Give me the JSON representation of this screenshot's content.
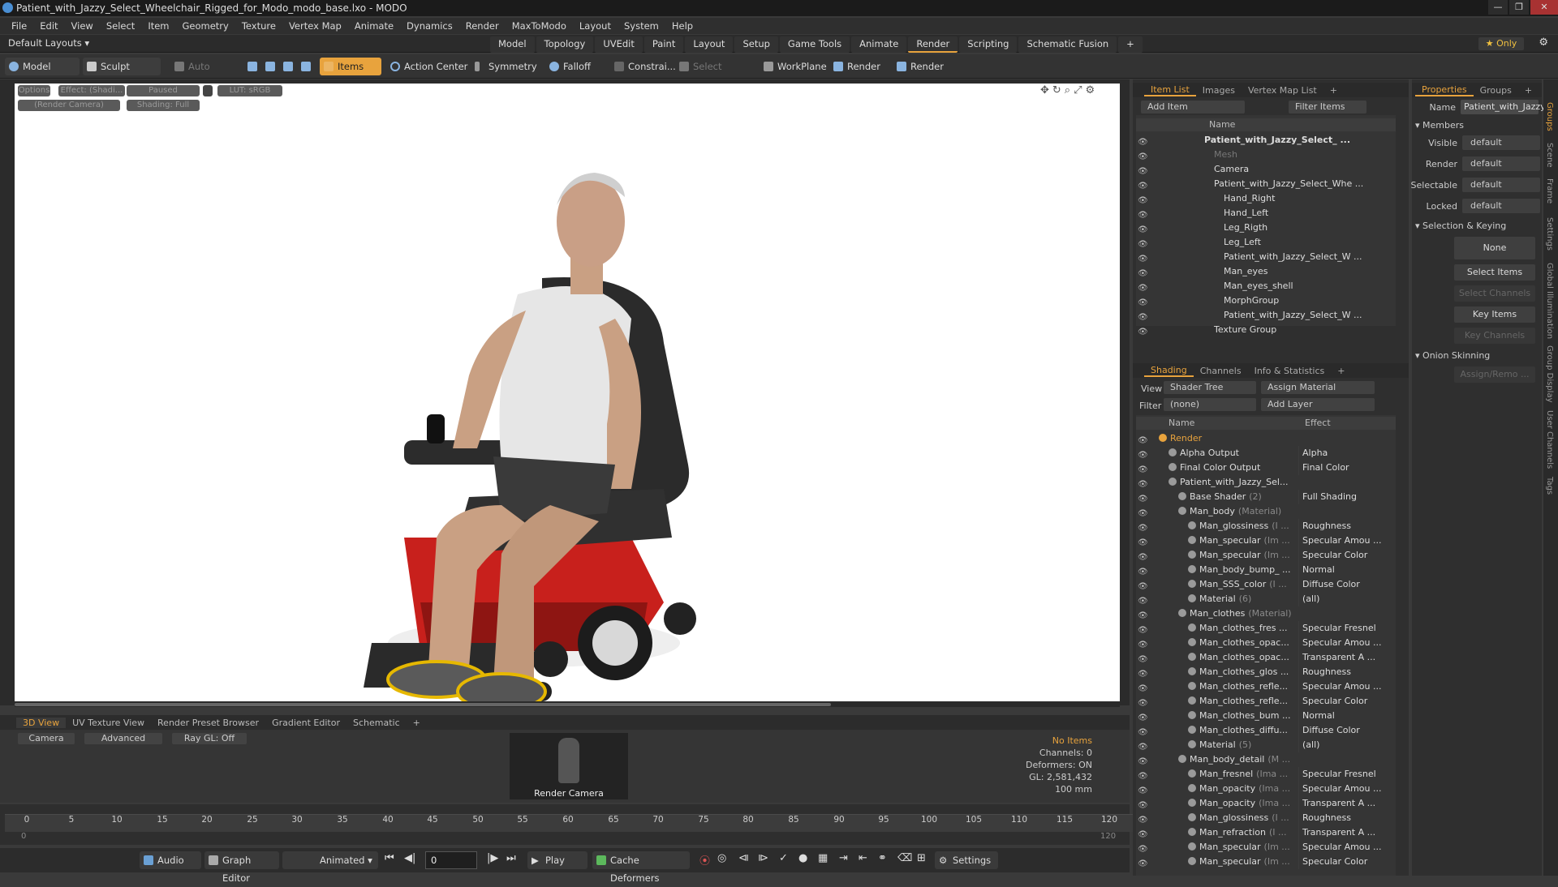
{
  "window": {
    "title": "Patient_with_Jazzy_Select_Wheelchair_Rigged_for_Modo_modo_base.lxo - MODO",
    "buttons": [
      "—",
      "❐",
      "✕"
    ]
  },
  "menu": [
    "File",
    "Edit",
    "View",
    "Select",
    "Item",
    "Geometry",
    "Texture",
    "Vertex Map",
    "Animate",
    "Dynamics",
    "Render",
    "MaxToModo",
    "Layout",
    "System",
    "Help"
  ],
  "layoutbar": {
    "default_layouts": "Default Layouts ▾",
    "tabs": [
      "Model",
      "Topology",
      "UVEdit",
      "Paint",
      "Layout",
      "Setup",
      "Game Tools",
      "Animate",
      "Render",
      "Scripting",
      "Schematic Fusion",
      "+"
    ],
    "active_tab": "Render",
    "only": "★ Only"
  },
  "toolbar": {
    "model": "Model",
    "sculpt": "Sculpt",
    "auto_select": "Auto Select",
    "items": "Items",
    "action_center": "Action Center",
    "symmetry": "Symmetry",
    "falloff": "Falloff",
    "constrain": "Constrai...",
    "select_through": "Select Through",
    "workplane": "WorkPlane",
    "render": "Render",
    "render_window": "Render Window"
  },
  "viewport": {
    "chips": [
      "Options",
      "Effect: (Shadi...",
      "Paused",
      "LUT: sRGB",
      "(Render Camera)",
      "Shading: Full"
    ]
  },
  "bottom": {
    "tabs": [
      "3D View",
      "UV Texture View",
      "Render Preset Browser",
      "Gradient Editor",
      "Schematic",
      "+"
    ],
    "active_tab": "3D View",
    "camera": "Camera",
    "advanced": "Advanced",
    "raygl": "Ray GL: Off",
    "thumb_label": "Render Camera",
    "stats": {
      "no_items": "No Items",
      "channels": "Channels: 0",
      "deformers": "Deformers: ON",
      "gl": "GL: 2,581,432",
      "scale": "100 mm"
    }
  },
  "timeline": {
    "ticks": [
      "0",
      "5",
      "10",
      "15",
      "20",
      "25",
      "30",
      "35",
      "40",
      "45",
      "50",
      "55",
      "60",
      "65",
      "70",
      "75",
      "80",
      "85",
      "90",
      "95",
      "100",
      "105",
      "110",
      "115",
      "120"
    ],
    "start": "0",
    "end": "120"
  },
  "transport": {
    "audio": "Audio",
    "graph_editor": "Graph Editor",
    "animated": "Animated",
    "frame": "0",
    "play": "Play",
    "cache": "Cache Deformers",
    "settings": "Settings"
  },
  "item_list": {
    "tabs": [
      "Item List",
      "Images",
      "Vertex Map List",
      "+"
    ],
    "active_tab": "Item List",
    "add_item": "Add Item",
    "filter": "Filter Items",
    "header": "Name",
    "rows": [
      {
        "name": "Patient_with_Jazzy_Select_ ...",
        "indent": 0,
        "bold": true
      },
      {
        "name": "Mesh",
        "indent": 1,
        "dim": true
      },
      {
        "name": "Camera",
        "indent": 1
      },
      {
        "name": "Patient_with_Jazzy_Select_Whe ...",
        "indent": 1
      },
      {
        "name": "Hand_Right",
        "indent": 2
      },
      {
        "name": "Hand_Left",
        "indent": 2
      },
      {
        "name": "Leg_Rigth",
        "indent": 2
      },
      {
        "name": "Leg_Left",
        "indent": 2
      },
      {
        "name": "Patient_with_Jazzy_Select_W ...",
        "indent": 2
      },
      {
        "name": "Man_eyes",
        "indent": 2
      },
      {
        "name": "Man_eyes_shell",
        "indent": 2
      },
      {
        "name": "MorphGroup",
        "indent": 2
      },
      {
        "name": "Patient_with_Jazzy_Select_W ...",
        "indent": 2
      },
      {
        "name": "Texture Group",
        "indent": 1
      }
    ]
  },
  "shading": {
    "tabs": [
      "Shading",
      "Channels",
      "Info & Statistics",
      "+"
    ],
    "active_tab": "Shading",
    "view_label": "View",
    "view_value": "Shader Tree",
    "assign": "Assign Material",
    "filter_label": "Filter",
    "filter_value": "(none)",
    "add_layer": "Add Layer",
    "header_name": "Name",
    "header_effect": "Effect",
    "rows": [
      {
        "name": "Render",
        "tag": "",
        "effect": "",
        "indent": 0,
        "color": "#e8a33d"
      },
      {
        "name": "Alpha Output",
        "tag": "",
        "effect": "Alpha",
        "indent": 1
      },
      {
        "name": "Final Color Output",
        "tag": "",
        "effect": "Final Color",
        "indent": 1
      },
      {
        "name": "Patient_with_Jazzy_Sel...",
        "tag": "",
        "effect": "",
        "indent": 1
      },
      {
        "name": "Base Shader",
        "tag": "(2)",
        "effect": "Full Shading",
        "indent": 2
      },
      {
        "name": "Man_body",
        "tag": "(Material)",
        "effect": "",
        "indent": 2
      },
      {
        "name": "Man_glossiness",
        "tag": "(I ...",
        "effect": "Roughness",
        "indent": 3
      },
      {
        "name": "Man_specular",
        "tag": "(Im ...",
        "effect": "Specular Amou ...",
        "indent": 3
      },
      {
        "name": "Man_specular",
        "tag": "(Im ...",
        "effect": "Specular Color",
        "indent": 3
      },
      {
        "name": "Man_body_bump_ ...",
        "tag": "",
        "effect": "Normal",
        "indent": 3
      },
      {
        "name": "Man_SSS_color",
        "tag": "(I ...",
        "effect": "Diffuse Color",
        "indent": 3
      },
      {
        "name": "Material",
        "tag": "(6)",
        "effect": "(all)",
        "indent": 3
      },
      {
        "name": "Man_clothes",
        "tag": "(Material)",
        "effect": "",
        "indent": 2
      },
      {
        "name": "Man_clothes_fres ...",
        "tag": "",
        "effect": "Specular Fresnel",
        "indent": 3
      },
      {
        "name": "Man_clothes_opac...",
        "tag": "",
        "effect": "Specular Amou ...",
        "indent": 3
      },
      {
        "name": "Man_clothes_opac...",
        "tag": "",
        "effect": "Transparent A ...",
        "indent": 3
      },
      {
        "name": "Man_clothes_glos ...",
        "tag": "",
        "effect": "Roughness",
        "indent": 3
      },
      {
        "name": "Man_clothes_refle...",
        "tag": "",
        "effect": "Specular Amou ...",
        "indent": 3
      },
      {
        "name": "Man_clothes_refle...",
        "tag": "",
        "effect": "Specular Color",
        "indent": 3
      },
      {
        "name": "Man_clothes_bum ...",
        "tag": "",
        "effect": "Normal",
        "indent": 3
      },
      {
        "name": "Man_clothes_diffu...",
        "tag": "",
        "effect": "Diffuse Color",
        "indent": 3
      },
      {
        "name": "Material",
        "tag": "(5)",
        "effect": "(all)",
        "indent": 3
      },
      {
        "name": "Man_body_detail",
        "tag": "(M ...",
        "effect": "",
        "indent": 2
      },
      {
        "name": "Man_fresnel",
        "tag": "(Ima ...",
        "effect": "Specular Fresnel",
        "indent": 3
      },
      {
        "name": "Man_opacity",
        "tag": "(Ima ...",
        "effect": "Specular Amou ...",
        "indent": 3
      },
      {
        "name": "Man_opacity",
        "tag": "(Ima ...",
        "effect": "Transparent A ...",
        "indent": 3
      },
      {
        "name": "Man_glossiness",
        "tag": "(I ...",
        "effect": "Roughness",
        "indent": 3
      },
      {
        "name": "Man_refraction",
        "tag": "(I ...",
        "effect": "Transparent A ...",
        "indent": 3
      },
      {
        "name": "Man_specular",
        "tag": "(Im ...",
        "effect": "Specular Amou ...",
        "indent": 3
      },
      {
        "name": "Man_specular",
        "tag": "(Im ...",
        "effect": "Specular Color",
        "indent": 3
      }
    ]
  },
  "properties": {
    "tabs": [
      "Properties",
      "Groups",
      "+"
    ],
    "active_tab": "Properties",
    "name_label": "Name",
    "name_value": "Patient_with_Jazzy",
    "members": "Members",
    "fields": [
      {
        "label": "Visible",
        "value": "default"
      },
      {
        "label": "Render",
        "value": "default"
      },
      {
        "label": "Selectable",
        "value": "default"
      },
      {
        "label": "Locked",
        "value": "default"
      }
    ],
    "selection_keying": "Selection & Keying",
    "none": "None",
    "select_items": "Select Items",
    "select_channels": "Select Channels",
    "key_items": "Key Items",
    "key_channels": "Key Channels",
    "onion": "Onion Skinning",
    "assign_remove": "Assign/Remo ..."
  },
  "side_tabs": [
    "Groups",
    "Scene",
    "Frame",
    "Settings",
    "Global Illumination",
    "Group Display",
    "User Channels",
    "Tags"
  ],
  "colors": {
    "accent": "#e8a33d",
    "chair_red": "#c8201c",
    "skin": "#c9a083"
  }
}
